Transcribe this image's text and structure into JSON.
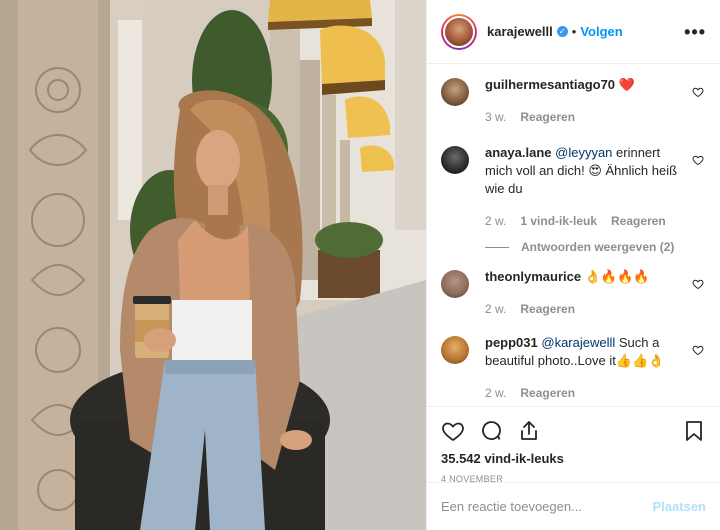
{
  "header": {
    "username": "karajewelll",
    "separator": "•",
    "follow_label": "Volgen",
    "more_label": "•••"
  },
  "comments": [
    {
      "username": "guilhermesantiago70",
      "text": "❤️",
      "mention": "",
      "time": "3 w.",
      "likes": "",
      "reply_label": "Reageren",
      "avatar_color": "#7a5a3a"
    },
    {
      "username": "anaya.lane",
      "mention": "@leyyyan",
      "text": " erinnert mich voll an dich! 😍 Ähnlich heiß wie du",
      "time": "2 w.",
      "likes": "1 vind-ik-leuk",
      "reply_label": "Reageren",
      "view_replies": "Antwoorden weergeven (2)",
      "avatar_color": "#2a2a2a"
    },
    {
      "username": "theonlymaurice",
      "text": "👌🔥🔥🔥",
      "mention": "",
      "time": "2 w.",
      "likes": "",
      "reply_label": "Reageren",
      "avatar_color": "#8a6a58"
    },
    {
      "username": "pepp031",
      "mention": "@karajewelll",
      "text": " Such a beautiful photo..Love it👍👍👌",
      "time": "2 w.",
      "likes": "",
      "reply_label": "Reageren",
      "avatar_color": "#b5722e"
    }
  ],
  "footer": {
    "likes_count": "35.542 vind-ik-leuks",
    "date": "4 NOVEMBER",
    "comment_placeholder": "Een reactie toevoegen...",
    "post_label": "Plaatsen"
  },
  "icons": [
    "heart-icon",
    "comment-icon",
    "share-icon",
    "bookmark-icon",
    "verified-icon",
    "more-icon"
  ],
  "colors": {
    "accent": "#0095f6",
    "verified": "#3897f0",
    "post_disabled": "#b2dffc",
    "muted": "#8e8e8e"
  }
}
